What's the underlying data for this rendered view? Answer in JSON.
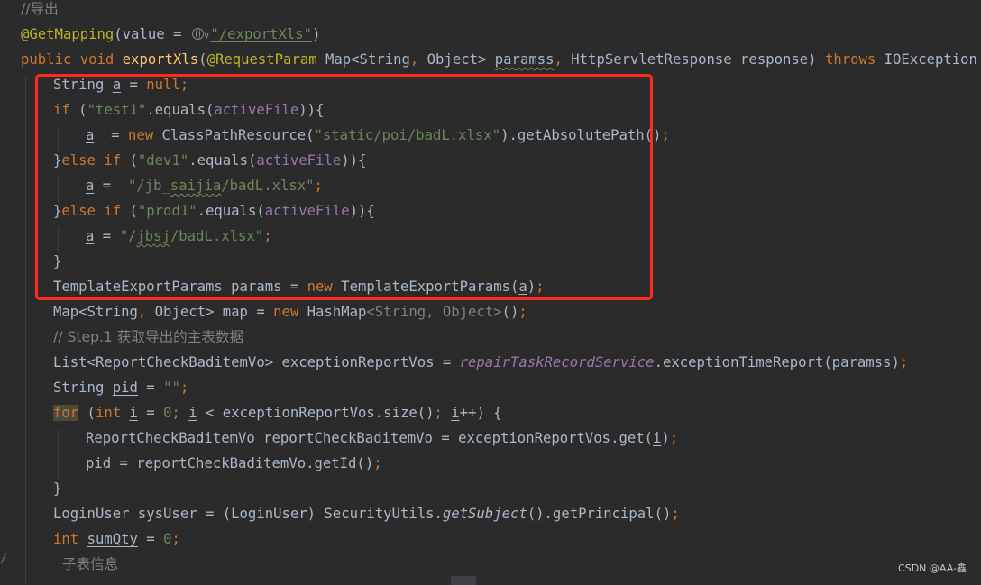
{
  "theme": {
    "background": "#2b2b2b",
    "highlight_border": "#ff2a1f",
    "colors": {
      "default": "#a9b7c6",
      "comment": "#808080",
      "keyword": "#cc7832",
      "string": "#6a8759",
      "annotation": "#bbb529",
      "method": "#ffc66d",
      "field": "#9876aa"
    }
  },
  "code_lines": [
    {
      "indent": 0,
      "tokens": [
        {
          "t": "//导出",
          "c": "comment"
        }
      ]
    },
    {
      "indent": 0,
      "tokens": [
        {
          "t": "@GetMapping",
          "c": "anno"
        },
        {
          "t": "(value = ",
          "c": "default"
        },
        {
          "t": "",
          "c": "globe"
        },
        {
          "t": "\"/exportXls\"",
          "c": "string",
          "u": "su"
        },
        {
          "t": ")",
          "c": "default"
        }
      ]
    },
    {
      "indent": 0,
      "tokens": [
        {
          "t": "public void ",
          "c": "keyword"
        },
        {
          "t": "exportXls",
          "c": "method"
        },
        {
          "t": "(",
          "c": "default"
        },
        {
          "t": "@RequestParam ",
          "c": "anno"
        },
        {
          "t": "Map<String",
          "c": "default"
        },
        {
          "t": ", ",
          "c": "keyword"
        },
        {
          "t": "Object> ",
          "c": "default"
        },
        {
          "t": "paramss",
          "c": "default",
          "u": "wavy"
        },
        {
          "t": ", ",
          "c": "keyword"
        },
        {
          "t": "HttpServletResponse response) ",
          "c": "default"
        },
        {
          "t": "throws ",
          "c": "keyword"
        },
        {
          "t": "IOException {",
          "c": "default"
        }
      ]
    },
    {
      "indent": 1,
      "tokens": [
        {
          "t": "String ",
          "c": "default"
        },
        {
          "t": "a",
          "c": "default",
          "u": "u"
        },
        {
          "t": " = ",
          "c": "default"
        },
        {
          "t": "null;",
          "c": "keyword"
        }
      ]
    },
    {
      "indent": 1,
      "tokens": [
        {
          "t": "if ",
          "c": "keyword"
        },
        {
          "t": "(",
          "c": "default"
        },
        {
          "t": "\"test1\"",
          "c": "string"
        },
        {
          "t": ".equals(",
          "c": "default"
        },
        {
          "t": "activeFile",
          "c": "field"
        },
        {
          "t": ")){",
          "c": "default"
        }
      ]
    },
    {
      "indent": 2,
      "tokens": [
        {
          "t": "a",
          "c": "default",
          "u": "u"
        },
        {
          "t": "  = ",
          "c": "default"
        },
        {
          "t": "new ",
          "c": "keyword"
        },
        {
          "t": "ClassPathResource(",
          "c": "default"
        },
        {
          "t": "\"static/poi/badL.xlsx\"",
          "c": "string"
        },
        {
          "t": ").getAbsolutePath()",
          "c": "default"
        },
        {
          "t": ";",
          "c": "keyword"
        }
      ]
    },
    {
      "indent": 1,
      "tokens": [
        {
          "t": "}",
          "c": "default"
        },
        {
          "t": "else if ",
          "c": "keyword"
        },
        {
          "t": "(",
          "c": "default"
        },
        {
          "t": "\"dev1\"",
          "c": "string"
        },
        {
          "t": ".equals(",
          "c": "default"
        },
        {
          "t": "activeFile",
          "c": "field"
        },
        {
          "t": ")){",
          "c": "default"
        }
      ]
    },
    {
      "indent": 2,
      "tokens": [
        {
          "t": "a",
          "c": "default",
          "u": "u"
        },
        {
          "t": " =  ",
          "c": "default"
        },
        {
          "t": "\"/jb_",
          "c": "string"
        },
        {
          "t": "saijia",
          "c": "string",
          "u": "wavy"
        },
        {
          "t": "/badL.xlsx\"",
          "c": "string"
        },
        {
          "t": ";",
          "c": "keyword"
        }
      ]
    },
    {
      "indent": 1,
      "tokens": [
        {
          "t": "}",
          "c": "default"
        },
        {
          "t": "else if ",
          "c": "keyword"
        },
        {
          "t": "(",
          "c": "default"
        },
        {
          "t": "\"prod1\"",
          "c": "string"
        },
        {
          "t": ".equals(",
          "c": "default"
        },
        {
          "t": "activeFile",
          "c": "field"
        },
        {
          "t": ")){",
          "c": "default"
        }
      ]
    },
    {
      "indent": 2,
      "tokens": [
        {
          "t": "a",
          "c": "default",
          "u": "u"
        },
        {
          "t": " = ",
          "c": "default"
        },
        {
          "t": "\"/",
          "c": "string"
        },
        {
          "t": "jbsj",
          "c": "string",
          "u": "wavy"
        },
        {
          "t": "/badL.xlsx\"",
          "c": "string"
        },
        {
          "t": ";",
          "c": "keyword"
        }
      ]
    },
    {
      "indent": 1,
      "tokens": [
        {
          "t": "}",
          "c": "default"
        }
      ]
    },
    {
      "indent": 1,
      "tokens": [
        {
          "t": "TemplateExportParams params = ",
          "c": "default"
        },
        {
          "t": "new ",
          "c": "keyword"
        },
        {
          "t": "TemplateExportParams(",
          "c": "default"
        },
        {
          "t": "a",
          "c": "default",
          "u": "u"
        },
        {
          "t": ")",
          "c": "default"
        },
        {
          "t": ";",
          "c": "keyword"
        }
      ]
    },
    {
      "indent": 1,
      "tokens": [
        {
          "t": "Map<String",
          "c": "default"
        },
        {
          "t": ", ",
          "c": "keyword"
        },
        {
          "t": "Object> map = ",
          "c": "default"
        },
        {
          "t": "new ",
          "c": "keyword"
        },
        {
          "t": "HashMap",
          "c": "default"
        },
        {
          "t": "<String, Object>",
          "c": "comment"
        },
        {
          "t": "()",
          "c": "default"
        },
        {
          "t": ";",
          "c": "keyword"
        }
      ]
    },
    {
      "indent": 1,
      "tokens": [
        {
          "t": "// Step.1 获取导出的主表数据",
          "c": "comment"
        }
      ]
    },
    {
      "indent": 1,
      "tokens": [
        {
          "t": "List<ReportCheckBaditemVo> exceptionReportVos = ",
          "c": "default"
        },
        {
          "t": "repairTaskRecordService",
          "c": "ifield"
        },
        {
          "t": ".exceptionTimeReport(paramss)",
          "c": "default"
        },
        {
          "t": ";",
          "c": "keyword"
        }
      ]
    },
    {
      "indent": 1,
      "tokens": [
        {
          "t": "String ",
          "c": "default"
        },
        {
          "t": "pid",
          "c": "default",
          "u": "u"
        },
        {
          "t": " = ",
          "c": "default"
        },
        {
          "t": "\"\"",
          "c": "string"
        },
        {
          "t": ";",
          "c": "keyword"
        }
      ]
    },
    {
      "indent": 1,
      "tokens": [
        {
          "t": "for",
          "c": "keyword",
          "bg": "for-bg"
        },
        {
          "t": " (",
          "c": "default"
        },
        {
          "t": "int ",
          "c": "keyword"
        },
        {
          "t": "i",
          "c": "default",
          "u": "u"
        },
        {
          "t": " = ",
          "c": "default"
        },
        {
          "t": "0",
          "c": "string"
        },
        {
          "t": "; ",
          "c": "keyword"
        },
        {
          "t": "i",
          "c": "default",
          "u": "u"
        },
        {
          "t": " < exceptionReportVos.size()",
          "c": "default"
        },
        {
          "t": "; ",
          "c": "keyword"
        },
        {
          "t": "i",
          "c": "default",
          "u": "u"
        },
        {
          "t": "++) {",
          "c": "default"
        }
      ]
    },
    {
      "indent": 2,
      "tokens": [
        {
          "t": "ReportCheckBaditemVo reportCheckBaditemVo = exceptionReportVos.get(",
          "c": "default"
        },
        {
          "t": "i",
          "c": "default",
          "u": "u"
        },
        {
          "t": ")",
          "c": "default"
        },
        {
          "t": ";",
          "c": "keyword"
        }
      ]
    },
    {
      "indent": 2,
      "tokens": [
        {
          "t": "pid",
          "c": "default",
          "u": "u"
        },
        {
          "t": " = reportCheckBaditemVo.getId()",
          "c": "default"
        },
        {
          "t": ";",
          "c": "keyword"
        }
      ]
    },
    {
      "indent": 1,
      "tokens": [
        {
          "t": "}",
          "c": "default"
        }
      ]
    },
    {
      "indent": 1,
      "tokens": [
        {
          "t": "LoginUser sysUser = (LoginUser) SecurityUtils.",
          "c": "default"
        },
        {
          "t": "getSubject",
          "c": "italic"
        },
        {
          "t": "().getPrincipal()",
          "c": "default"
        },
        {
          "t": ";",
          "c": "keyword"
        }
      ]
    },
    {
      "indent": 1,
      "tokens": [
        {
          "t": "int ",
          "c": "keyword"
        },
        {
          "t": "sumQty",
          "c": "default",
          "u": "u"
        },
        {
          "t": " = ",
          "c": "default"
        },
        {
          "t": "0",
          "c": "string"
        },
        {
          "t": ";",
          "c": "keyword"
        }
      ]
    },
    {
      "indent": 1,
      "tokens": [
        {
          "t": "  子表信息",
          "c": "comment"
        }
      ]
    }
  ],
  "watermark": "CSDN @AA-鑫",
  "gutter_mark": "/"
}
